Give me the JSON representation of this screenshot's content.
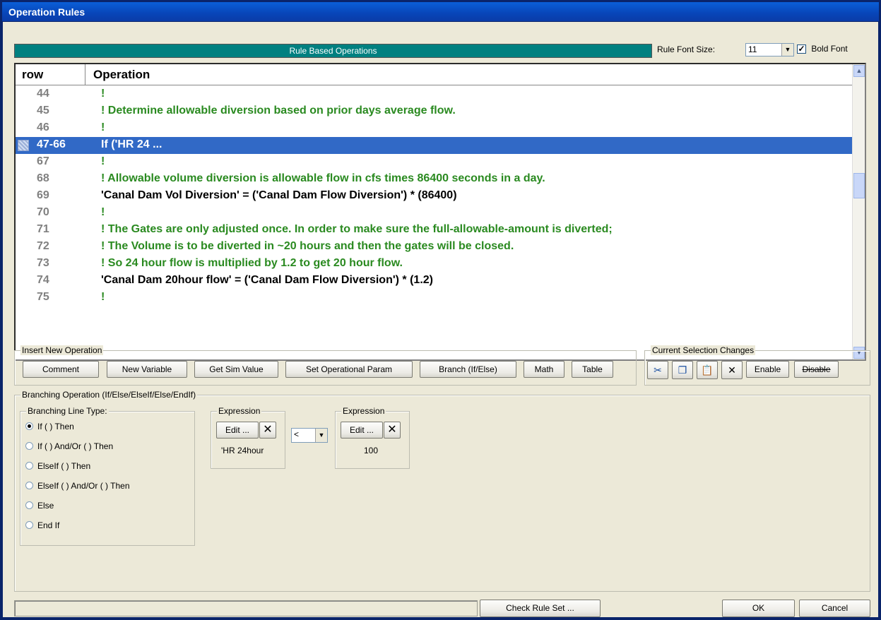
{
  "window": {
    "title": "Operation Rules"
  },
  "header": {
    "title": "Rule Based Operations",
    "font_size_label": "Rule Font Size:",
    "font_size_value": "11",
    "bold_font_label": "Bold Font",
    "bold_font_checked": true
  },
  "grid": {
    "col_row": "row",
    "col_operation": "Operation",
    "rows": [
      {
        "num": "44",
        "text": "!",
        "kind": "comment"
      },
      {
        "num": "45",
        "text": "! Determine allowable diversion based on prior days average flow.",
        "kind": "comment"
      },
      {
        "num": "46",
        "text": "!",
        "kind": "comment"
      },
      {
        "num": "47-66",
        "text": "If ('HR 24 ...",
        "kind": "selected"
      },
      {
        "num": "67",
        "text": "!",
        "kind": "comment"
      },
      {
        "num": "68",
        "text": "! Allowable volume diversion is allowable flow in cfs times 86400 seconds in a day.",
        "kind": "comment"
      },
      {
        "num": "69",
        "text": "'Canal Dam Vol Diversion' = ('Canal Dam Flow Diversion') * (86400)",
        "kind": "code"
      },
      {
        "num": "70",
        "text": "!",
        "kind": "comment"
      },
      {
        "num": "71",
        "text": "! The Gates are only adjusted once.  In order to make sure the full-allowable-amount is diverted;",
        "kind": "comment"
      },
      {
        "num": "72",
        "text": "! The Volume is to be diverted in ~20 hours and then the gates will be closed.",
        "kind": "comment"
      },
      {
        "num": "73",
        "text": "! So 24 hour flow is multiplied by 1.2 to get 20 hour flow.",
        "kind": "comment"
      },
      {
        "num": "74",
        "text": "'Canal Dam 20hour flow' = ('Canal Dam Flow Diversion') * (1.2)",
        "kind": "code"
      },
      {
        "num": "75",
        "text": "!",
        "kind": "comment"
      }
    ]
  },
  "insert": {
    "legend": "Insert New Operation",
    "buttons": [
      "Comment",
      "New Variable",
      "Get Sim Value",
      "Set Operational Param",
      "Branch (If/Else)",
      "Math",
      "Table"
    ]
  },
  "selection": {
    "legend": "Current Selection Changes",
    "enable": "Enable",
    "disable": "Disable"
  },
  "branching": {
    "legend": "Branching Operation (If/Else/ElseIf/Else/EndIf)",
    "type_legend": "Branching Line Type:",
    "types": [
      "If ( ) Then",
      "If ( ) And/Or ( ) Then",
      "ElseIf ( ) Then",
      "ElseIf ( ) And/Or ( ) Then",
      "Else",
      "End If"
    ],
    "selected_type": 0,
    "expr1": {
      "legend": "Expression",
      "edit": "Edit ...",
      "value": "'HR 24hour"
    },
    "operator": "<",
    "expr2": {
      "legend": "Expression",
      "edit": "Edit ...",
      "value": "100"
    }
  },
  "footer": {
    "check": "Check Rule Set ...",
    "ok": "OK",
    "cancel": "Cancel"
  },
  "colors": {
    "comment": "#2a8a20",
    "selection": "#3169c6",
    "header": "#008080"
  }
}
